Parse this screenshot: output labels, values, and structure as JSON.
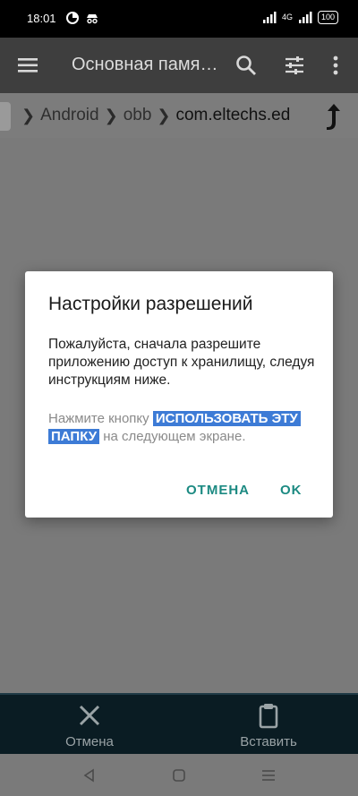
{
  "status": {
    "time": "18:01",
    "network": "4G",
    "battery": "100"
  },
  "app_bar": {
    "title": "Основная памя…"
  },
  "breadcrumb": {
    "items": [
      "Android",
      "obb",
      "com.eltechs.ed"
    ]
  },
  "dialog": {
    "title": "Настройки разрешений",
    "message": "Пожалуйста, сначала разрешите приложению доступ к хранилищу, следуя инструкциям ниже.",
    "hint_prefix": "Нажмите кнопку ",
    "hint_highlight_1": "ИСПОЛЬЗОВАТЬ ЭТУ",
    "hint_highlight_2": "ПАПКУ",
    "hint_suffix": " на следующем экране.",
    "cancel_label": "ОТМЕНА",
    "ok_label": "OK"
  },
  "bottom_bar": {
    "cancel_label": "Отмена",
    "paste_label": "Вставить"
  },
  "colors": {
    "accent": "#1c8a82",
    "highlight": "#3d7bd6",
    "app_bar": "#3e3e3e",
    "bottom_bar": "#0a1c23"
  }
}
